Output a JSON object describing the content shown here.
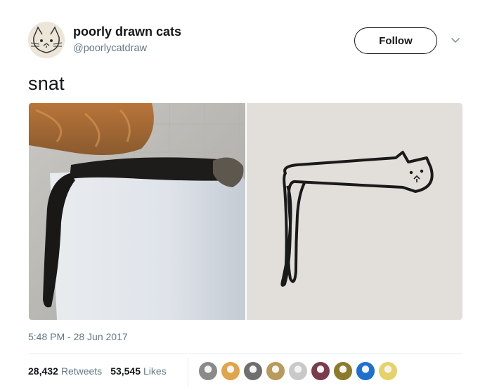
{
  "account": {
    "display_name": "poorly drawn cats",
    "handle": "@poorlycatdraw",
    "avatar_icon": "cat-face-drawing",
    "avatar_color": "#ece6d9"
  },
  "actions": {
    "follow_label": "Follow",
    "more_icon": "chevron-down-icon"
  },
  "tweet": {
    "text": "snat",
    "media": [
      {
        "icon": "photo-cat-on-fridge"
      },
      {
        "icon": "drawing-long-cat"
      }
    ],
    "timestamp": "5:48 PM - 28 Jun 2017"
  },
  "stats": {
    "retweets_count": "28,432",
    "retweets_label": "Retweets",
    "likes_count": "53,545",
    "likes_label": "Likes"
  },
  "likers": [
    {
      "color": "#8a8a8a"
    },
    {
      "color": "#e0a54a"
    },
    {
      "color": "#6f6f6f"
    },
    {
      "color": "#b89a5a"
    },
    {
      "color": "#c9c9c9"
    },
    {
      "color": "#7a3b4a"
    },
    {
      "color": "#8a7a2a"
    },
    {
      "color": "#1f6fcf"
    },
    {
      "color": "#e5d36a"
    }
  ],
  "colors": {
    "text_primary": "#14171a",
    "text_secondary": "#657786",
    "divider": "#e6ecf0"
  }
}
